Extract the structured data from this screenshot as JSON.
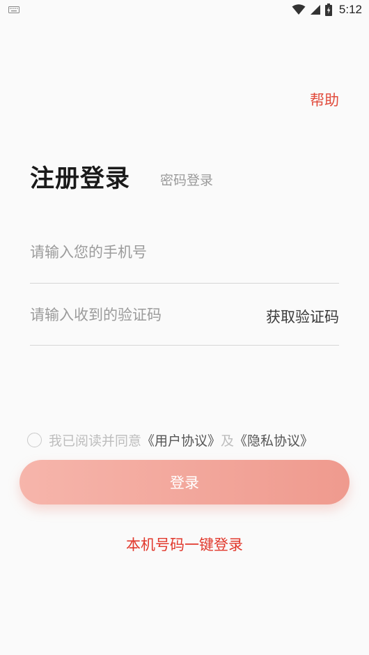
{
  "status_bar": {
    "time": "5:12",
    "icons": [
      "keyboard-icon",
      "wifi-icon",
      "signal-icon",
      "battery-charging-icon"
    ]
  },
  "header": {
    "help_label": "帮助"
  },
  "title": {
    "main": "注册登录",
    "alt_tab": "密码登录"
  },
  "form": {
    "phone_placeholder": "请输入您的手机号",
    "code_placeholder": "请输入收到的验证码",
    "get_code_label": "获取验证码"
  },
  "agreement": {
    "prefix": "我已阅读并同意",
    "user_agreement": "《用户协议》",
    "joiner": "及",
    "privacy_policy": "《隐私协议》"
  },
  "actions": {
    "login_label": "登录",
    "one_click_label": "本机号码一键登录"
  },
  "colors": {
    "accent_red": "#e14a3b",
    "button_gradient_start": "#f6b5ab",
    "button_gradient_end": "#ef9a8e",
    "background": "#fafafa"
  }
}
